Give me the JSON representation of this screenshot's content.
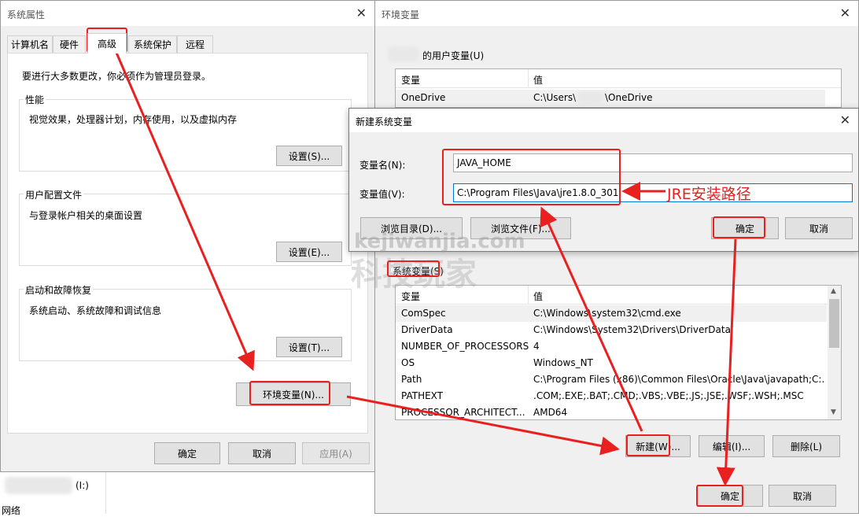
{
  "sysprops": {
    "title": "系统属性",
    "tabs": [
      "计算机名",
      "硬件",
      "高级",
      "系统保护",
      "远程"
    ],
    "admin_note": "要进行大多数更改，你必须作为管理员登录。",
    "performance": {
      "label": "性能",
      "desc": "视觉效果，处理器计划，内存使用，以及虚拟内存",
      "button": "设置(S)..."
    },
    "profile": {
      "label": "用户配置文件",
      "desc": "与登录帐户相关的桌面设置",
      "button": "设置(E)..."
    },
    "startup": {
      "label": "启动和故障恢复",
      "desc": "系统启动、系统故障和调试信息",
      "button": "设置(T)..."
    },
    "env_button": "环境变量(N)...",
    "ok": "确定",
    "cancel": "取消",
    "apply": "应用(A)",
    "below_text_1": "(I:)",
    "below_text_2": "网络"
  },
  "envvars": {
    "title": "环境变量",
    "user_section_suffix": "的用户变量(U)",
    "user_table": {
      "headers": [
        "变量",
        "值"
      ],
      "rows": [
        [
          "OneDrive",
          "C:\\Users\\",
          "\\OneDrive"
        ]
      ]
    },
    "system_section": "系统变量(S)",
    "system_table": {
      "headers": [
        "变量",
        "值"
      ],
      "rows": [
        [
          "ComSpec",
          "C:\\Windows\\system32\\cmd.exe"
        ],
        [
          "DriverData",
          "C:\\Windows\\System32\\Drivers\\DriverData"
        ],
        [
          "NUMBER_OF_PROCESSORS",
          "4"
        ],
        [
          "OS",
          "Windows_NT"
        ],
        [
          "Path",
          "C:\\Program Files (x86)\\Common Files\\Oracle\\Java\\javapath;C:..."
        ],
        [
          "PATHEXT",
          ".COM;.EXE;.BAT;.CMD;.VBS;.VBE;.JS;.JSE;.WSF;.WSH;.MSC"
        ],
        [
          "PROCESSOR_ARCHITECT...",
          "AMD64"
        ]
      ]
    },
    "new_button": "新建(W)...",
    "edit_button": "编辑(I)...",
    "delete_button": "删除(L)",
    "ok": "确定",
    "cancel": "取消"
  },
  "newvar": {
    "title": "新建系统变量",
    "name_label": "变量名(N):",
    "value_label": "变量值(V):",
    "name_value": "JAVA_HOME",
    "value_value": "C:\\Program Files\\Java\\jre1.8.0_301",
    "browse_dir": "浏览目录(D)...",
    "browse_file": "浏览文件(F)...",
    "ok": "确定",
    "cancel": "取消"
  },
  "annotation": "JRE安装路径",
  "watermark": {
    "line1": "kejiwanjia.com",
    "line2": "科技玩家"
  },
  "colors": {
    "annotation_red": "#e8201f",
    "window_bg": "#f0f0f0"
  },
  "icons": [
    "close-icon",
    "scroll-up-icon",
    "scroll-down-icon"
  ]
}
